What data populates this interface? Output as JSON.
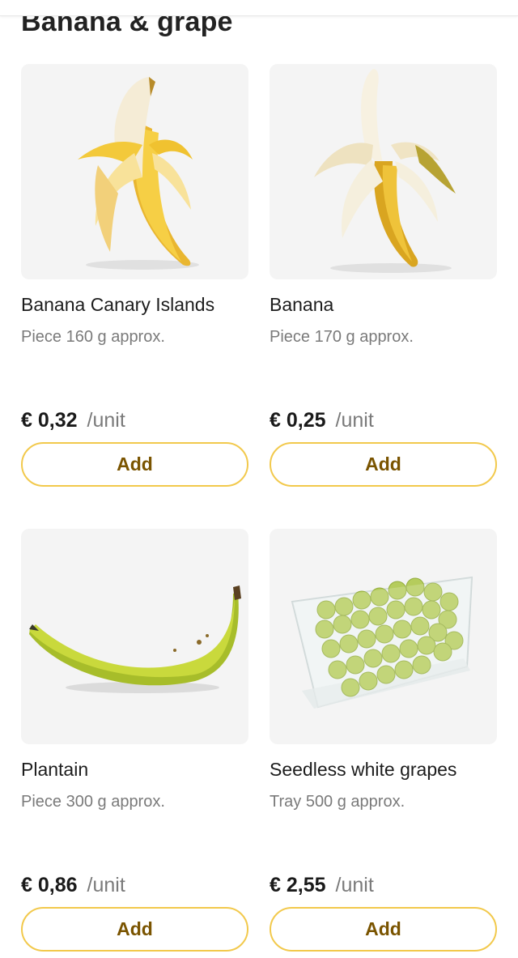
{
  "section": {
    "title": "Banana & grape"
  },
  "products": [
    {
      "name": "Banana Canary Islands",
      "detail": "Piece 160 g approx.",
      "price": "€ 0,32",
      "unit": "/unit",
      "button": "Add",
      "image": "peeled-banana"
    },
    {
      "name": "Banana",
      "detail": "Piece 170 g approx.",
      "price": "€ 0,25",
      "unit": "/unit",
      "button": "Add",
      "image": "peeled-banana"
    },
    {
      "name": "Plantain",
      "detail": "Piece 300 g approx.",
      "price": "€ 0,86",
      "unit": "/unit",
      "button": "Add",
      "image": "plantain"
    },
    {
      "name": "Seedless white grapes",
      "detail": "Tray 500 g approx.",
      "price": "€ 2,55",
      "unit": "/unit",
      "button": "Add",
      "image": "grapes-tray"
    }
  ],
  "colors": {
    "accent_border": "#f2c94c",
    "button_text": "#7a5400",
    "card_bg": "#f4f4f4"
  }
}
